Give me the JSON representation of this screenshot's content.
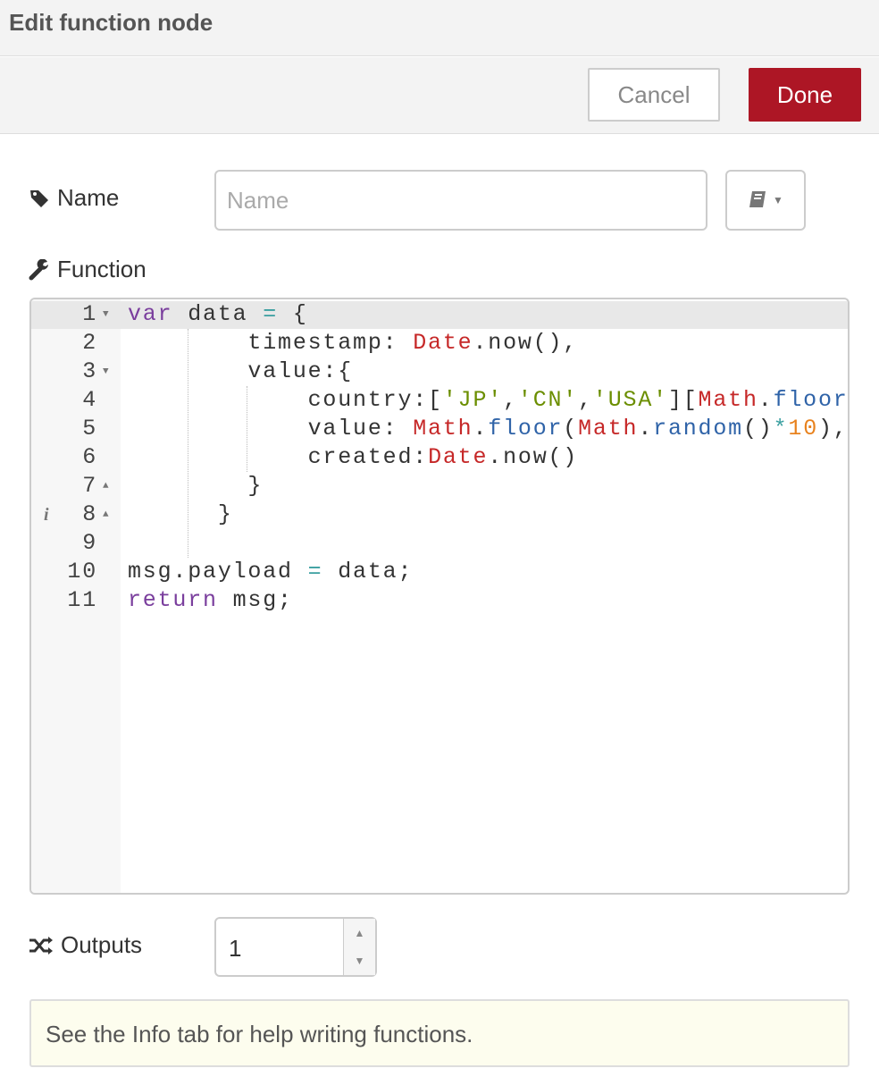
{
  "dialog": {
    "title": "Edit function node",
    "cancel_label": "Cancel",
    "done_label": "Done",
    "done_color": "#ad1625"
  },
  "name": {
    "label": "Name",
    "icon": "tag-icon",
    "value": "",
    "placeholder": "Name",
    "library_icon": "book-icon"
  },
  "function": {
    "label": "Function",
    "icon": "wrench-icon",
    "lines": [
      {
        "n": "1",
        "fold": "▼",
        "tokens": [
          [
            "kw",
            "var"
          ],
          [
            "p",
            " data "
          ],
          [
            "op",
            "="
          ],
          [
            "p",
            " {"
          ]
        ]
      },
      {
        "n": "2",
        "tokens": [
          [
            "p",
            "        timestamp: "
          ],
          [
            "bi",
            "Date"
          ],
          [
            "p",
            "."
          ],
          [
            "p",
            "now(),"
          ]
        ]
      },
      {
        "n": "3",
        "fold": "▼",
        "tokens": [
          [
            "p",
            "        value:{"
          ]
        ]
      },
      {
        "n": "4",
        "tokens": [
          [
            "p",
            "            country:["
          ],
          [
            "str",
            "'JP'"
          ],
          [
            "p",
            ","
          ],
          [
            "str",
            "'CN'"
          ],
          [
            "p",
            ","
          ],
          [
            "str",
            "'USA'"
          ],
          [
            "p",
            "]["
          ],
          [
            "bi",
            "Math"
          ],
          [
            "p",
            "."
          ],
          [
            "pr",
            "floor"
          ]
        ]
      },
      {
        "n": "5",
        "tokens": [
          [
            "p",
            "            value: "
          ],
          [
            "bi",
            "Math"
          ],
          [
            "p",
            "."
          ],
          [
            "pr",
            "floor"
          ],
          [
            "p",
            "("
          ],
          [
            "bi",
            "Math"
          ],
          [
            "p",
            "."
          ],
          [
            "pr",
            "random"
          ],
          [
            "p",
            "()"
          ],
          [
            "op",
            "*"
          ],
          [
            "num",
            "10"
          ],
          [
            "p",
            "),"
          ]
        ]
      },
      {
        "n": "6",
        "tokens": [
          [
            "p",
            "            created:"
          ],
          [
            "bi",
            "Date"
          ],
          [
            "p",
            ".now()"
          ]
        ]
      },
      {
        "n": "7",
        "fold": "▲",
        "tokens": [
          [
            "p",
            "        }"
          ]
        ]
      },
      {
        "n": "8",
        "fold": "▲",
        "info": "i",
        "tokens": [
          [
            "p",
            "      }"
          ]
        ]
      },
      {
        "n": "9",
        "tokens": []
      },
      {
        "n": "10",
        "tokens": [
          [
            "p",
            "msg.payload "
          ],
          [
            "op",
            "="
          ],
          [
            "p",
            " data;"
          ]
        ]
      },
      {
        "n": "11",
        "tokens": [
          [
            "kw",
            "return"
          ],
          [
            "p",
            " msg;"
          ]
        ]
      }
    ]
  },
  "outputs": {
    "label": "Outputs",
    "icon": "shuffle-icon",
    "value": "1"
  },
  "tip": {
    "text": "See the Info tab for help writing functions."
  }
}
